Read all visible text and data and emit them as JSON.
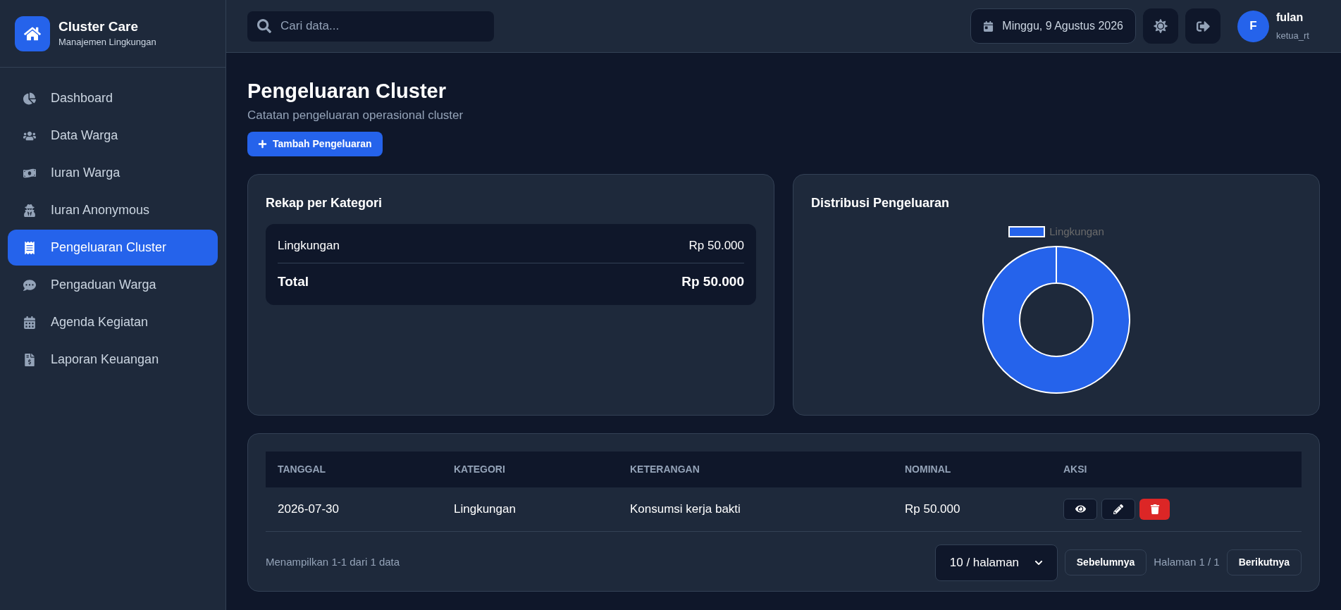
{
  "brand": {
    "title": "Cluster Care",
    "subtitle": "Manajemen Lingkungan"
  },
  "sidebar": {
    "items": [
      {
        "label": "Dashboard",
        "selected": false
      },
      {
        "label": "Data Warga",
        "selected": false
      },
      {
        "label": "Iuran Warga",
        "selected": false
      },
      {
        "label": "Iuran Anonymous",
        "selected": false
      },
      {
        "label": "Pengeluaran Cluster",
        "selected": true
      },
      {
        "label": "Pengaduan Warga",
        "selected": false
      },
      {
        "label": "Agenda Kegiatan",
        "selected": false
      },
      {
        "label": "Laporan Keuangan",
        "selected": false
      }
    ]
  },
  "header": {
    "search": {
      "placeholder": "Cari data..."
    },
    "date": "Minggu, 9 Agustus 2026",
    "user": {
      "initial": "F",
      "name": "fulan",
      "role": "ketua_rt"
    }
  },
  "page": {
    "title": "Pengeluaran Cluster",
    "subtitle": "Catatan pengeluaran operasional cluster",
    "add_button": "Tambah Pengeluaran"
  },
  "recap": {
    "title": "Rekap per Kategori",
    "rows": [
      {
        "label": "Lingkungan",
        "amount": "Rp 50.000"
      }
    ],
    "total": {
      "label": "Total",
      "amount": "Rp 50.000"
    }
  },
  "distribution": {
    "title": "Distribusi Pengeluaran",
    "legend": [
      {
        "label": "Lingkungan",
        "color": "#2563eb"
      }
    ]
  },
  "table": {
    "columns": [
      "TANGGAL",
      "KATEGORI",
      "KETERANGAN",
      "NOMINAL",
      "AKSI"
    ],
    "rows": [
      {
        "date": "2026-07-30",
        "category": "Lingkungan",
        "description": "Konsumsi kerja bakti",
        "amount": "Rp 50.000"
      }
    ],
    "summary": "Menampilkan 1-1 dari 1 data",
    "page_size": "10 / halaman",
    "prev": "Sebelumnya",
    "page_info": "Halaman 1 / 1",
    "next": "Berikutnya"
  }
}
